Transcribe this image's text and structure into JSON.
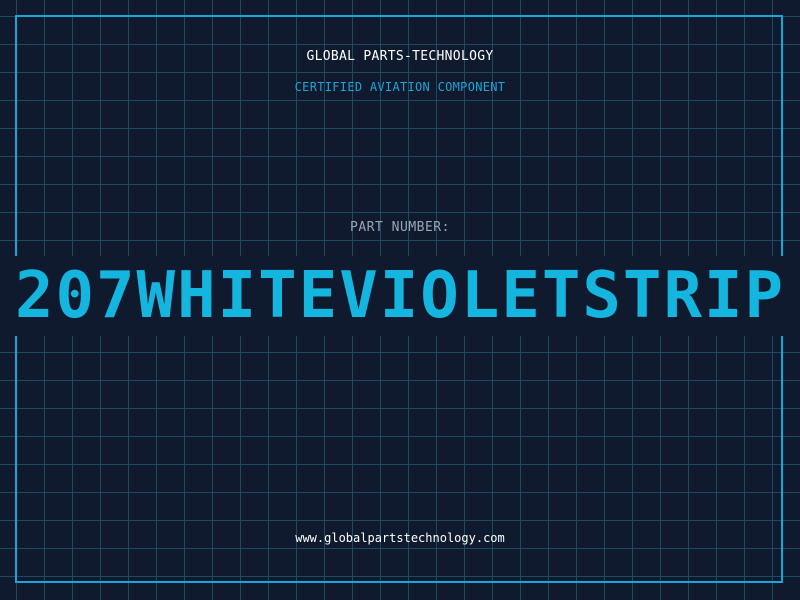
{
  "header": {
    "company": "GLOBAL PARTS-TECHNOLOGY",
    "subtitle": "CERTIFIED AVIATION COMPONENT"
  },
  "part": {
    "label": "PART NUMBER:",
    "number": "207WHITEVIOLETSTRIP"
  },
  "footer": {
    "url": "www.globalpartstechnology.com"
  },
  "colors": {
    "background": "#101a2e",
    "grid": "#1d4b62",
    "accent": "#1aa6d6",
    "part_number": "#14b6e0",
    "text": "#ffffff",
    "label": "#9aa6b8"
  }
}
